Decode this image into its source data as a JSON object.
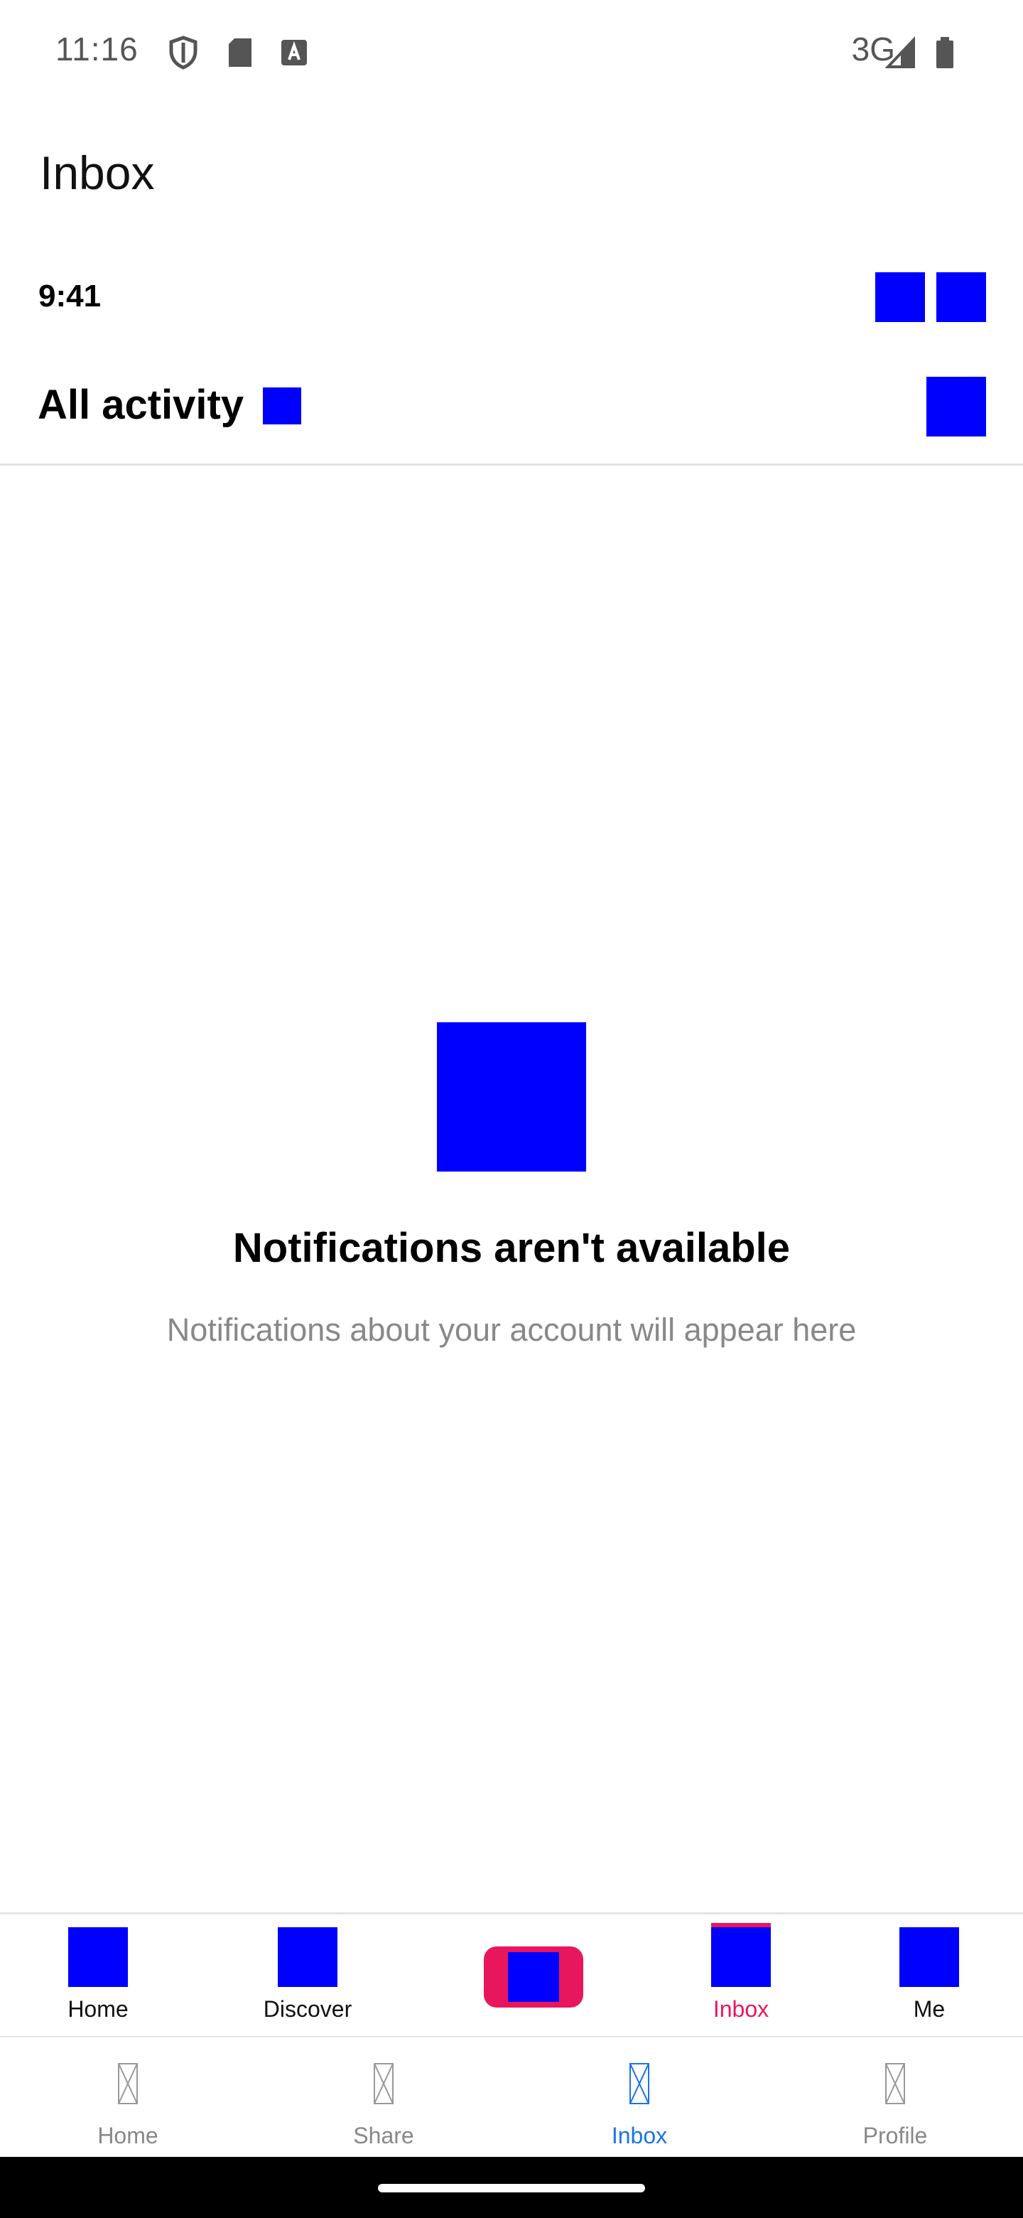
{
  "status_bar": {
    "time": "11:16",
    "network": "3G",
    "icons": [
      "shield-icon",
      "sd-card-icon",
      "keyboard-a-icon",
      "signal-icon",
      "battery-icon"
    ]
  },
  "app_header": {
    "title": "Inbox"
  },
  "content_header": {
    "time": "9:41",
    "title": "All activity"
  },
  "empty_state": {
    "title": "Notifications aren't available",
    "subtitle": "Notifications about your account will appear here"
  },
  "web_tabbar": {
    "items": [
      {
        "label": "Home"
      },
      {
        "label": "Discover"
      },
      {
        "label": "Inbox"
      },
      {
        "label": "Me"
      }
    ],
    "active_color": "#e8175d"
  },
  "native_nav": {
    "items": [
      {
        "label": "Home"
      },
      {
        "label": "Share"
      },
      {
        "label": "Inbox"
      },
      {
        "label": "Profile"
      }
    ],
    "active_color": "#1a73e8"
  },
  "colors": {
    "placeholder_blue": "#0000ff",
    "accent_pink": "#e8175d",
    "accent_blue": "#1a73e8"
  }
}
